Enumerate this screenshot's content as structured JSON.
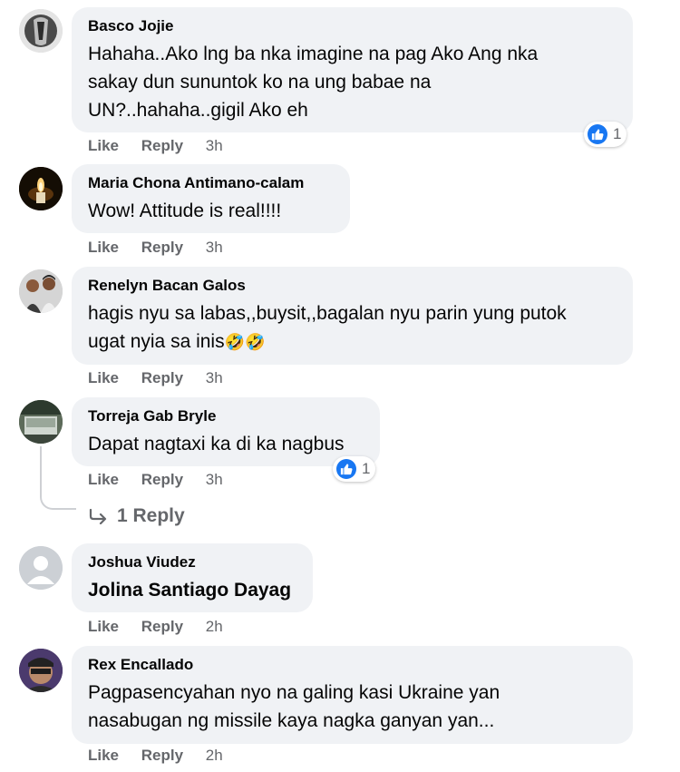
{
  "actions": {
    "like": "Like",
    "reply": "Reply"
  },
  "comments": [
    {
      "name": "Basco Jojie",
      "text": "Hahaha..Ako lng ba nka imagine na pag Ako Ang nka\nsakay dun sununtok ko na ung babae na\nUN?..hahaha..gigil Ako eh",
      "time": "3h",
      "reactions": "1"
    },
    {
      "name": "Maria Chona Antimano-calam",
      "text": "Wow! Attitude is real!!!!",
      "time": "3h"
    },
    {
      "name": "Renelyn Bacan Galos",
      "text": "hagis nyu sa labas,,buysit,,bagalan nyu parin yung putok\nugat nyia sa inis",
      "time": "3h",
      "emoji": "🤣🤣"
    },
    {
      "name": "Torreja Gab Bryle",
      "text": "Dapat nagtaxi ka di ka nagbus",
      "time": "3h",
      "reactions": "1",
      "replies": "1 Reply"
    },
    {
      "name": "Joshua Viudez",
      "text": "Jolina Santiago Dayag",
      "time": "2h"
    },
    {
      "name": "Rex Encallado",
      "text": "Pagpasencyahan nyo na galing kasi Ukraine yan\nnasabugan ng missile kaya nagka ganyan yan...",
      "time": "2h"
    }
  ],
  "colors": {
    "bubble": "#f0f2f5",
    "meta": "#65676b",
    "like": "#1877f2"
  }
}
